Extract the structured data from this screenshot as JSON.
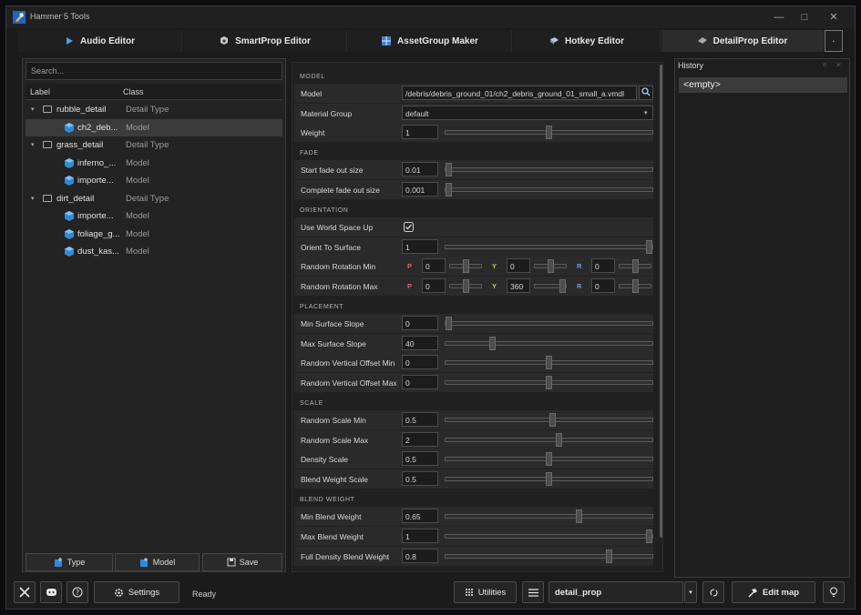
{
  "window": {
    "title": "Hammer 5 Tools",
    "controls": [
      "—",
      "□",
      "✕"
    ]
  },
  "tabs": [
    {
      "label": "Audio Editor",
      "icon": "play-icon"
    },
    {
      "label": "SmartProp Editor",
      "icon": "gear-cube-icon"
    },
    {
      "label": "AssetGroup Maker",
      "icon": "grid-icon"
    },
    {
      "label": "Hotkey Editor",
      "icon": "keyboard-icon"
    },
    {
      "label": "DetailProp Editor",
      "icon": "leaf-icon",
      "active": true
    }
  ],
  "left": {
    "search_placeholder": "Search...",
    "columns": {
      "label": "Label",
      "class": "Class"
    },
    "tree": [
      {
        "label": "rubble_detail",
        "class": "Detail Type",
        "level": 0
      },
      {
        "label": "ch2_deb...",
        "class": "Model",
        "level": 1,
        "selected": true
      },
      {
        "label": "grass_detail",
        "class": "Detail Type",
        "level": 0
      },
      {
        "label": "inferno_...",
        "class": "Model",
        "level": 1
      },
      {
        "label": "importe...",
        "class": "Model",
        "level": 1
      },
      {
        "label": "dirt_detail",
        "class": "Detail Type",
        "level": 0
      },
      {
        "label": "importe...",
        "class": "Model",
        "level": 1
      },
      {
        "label": "foliage_g...",
        "class": "Model",
        "level": 1
      },
      {
        "label": "dust_kas...",
        "class": "Model",
        "level": 1
      }
    ],
    "buttons": {
      "type": "Type",
      "model": "Model",
      "save": "Save"
    }
  },
  "props": {
    "sections": {
      "model": "MODEL",
      "fade": "FADE",
      "orientation": "ORIENTATION",
      "placement": "PLACEMENT",
      "scale": "SCALE",
      "blend": "BLEND WEIGHT"
    },
    "model": {
      "label": "Model",
      "value": "/debris/debris_ground_01/ch2_debris_ground_01_small_a.vmdl"
    },
    "material_group": {
      "label": "Material Group",
      "value": "default"
    },
    "weight": {
      "label": "Weight",
      "value": "1",
      "level": 0.5
    },
    "start_fade": {
      "label": "Start fade out size",
      "value": "0.01",
      "level": 0.0
    },
    "complete_fade": {
      "label": "Complete fade out size",
      "value": "0.001",
      "level": 0.0
    },
    "world_space": {
      "label": "Use World Space Up",
      "checked": true
    },
    "orient_surface": {
      "label": "Orient To Surface",
      "value": "1",
      "level": 1.0
    },
    "rot_min": {
      "label": "Random Rotation Min",
      "p": "0",
      "y": "0",
      "r": "0",
      "p_level": 0.5,
      "y_level": 0.5,
      "r_level": 0.5
    },
    "rot_max": {
      "label": "Random Rotation Max",
      "p": "0",
      "y": "360",
      "r": "0",
      "p_level": 0.5,
      "y_level": 1.0,
      "r_level": 0.5
    },
    "axis": {
      "p": "P",
      "y": "Y",
      "r": "R"
    },
    "min_slope": {
      "label": "Min Surface Slope",
      "value": "0",
      "level": 0.0
    },
    "max_slope": {
      "label": "Max Surface Slope",
      "value": "40",
      "level": 0.22
    },
    "vert_min": {
      "label": "Random Vertical Offset Min",
      "value": "0",
      "level": 0.5
    },
    "vert_max": {
      "label": "Random Vertical Offset Max",
      "value": "0",
      "level": 0.5
    },
    "scale_min": {
      "label": "Random Scale Min",
      "value": "0.5",
      "level": 0.52
    },
    "scale_max": {
      "label": "Random Scale Max",
      "value": "2",
      "level": 0.55
    },
    "density": {
      "label": "Density Scale",
      "value": "0.5",
      "level": 0.5
    },
    "blend_scale": {
      "label": "Blend Weight Scale",
      "value": "0.5",
      "level": 0.5
    },
    "min_blend": {
      "label": "Min Blend Weight",
      "value": "0.65",
      "level": 0.65
    },
    "max_blend": {
      "label": "Max Blend Weight",
      "value": "1",
      "level": 1.0
    },
    "full_blend": {
      "label": "Full Density Blend Weight",
      "value": "0.8",
      "level": 0.8
    }
  },
  "history": {
    "title": "History",
    "item": "<empty>"
  },
  "bottom": {
    "settings": "Settings",
    "status": "Ready",
    "utilities": "Utilities",
    "file": "detail_prop",
    "edit_map": "Edit map"
  },
  "colors": {
    "axis_p": "#e0665a",
    "axis_y": "#c8d24a",
    "axis_r": "#6f9bd9",
    "cube": "#2e8bd8"
  }
}
